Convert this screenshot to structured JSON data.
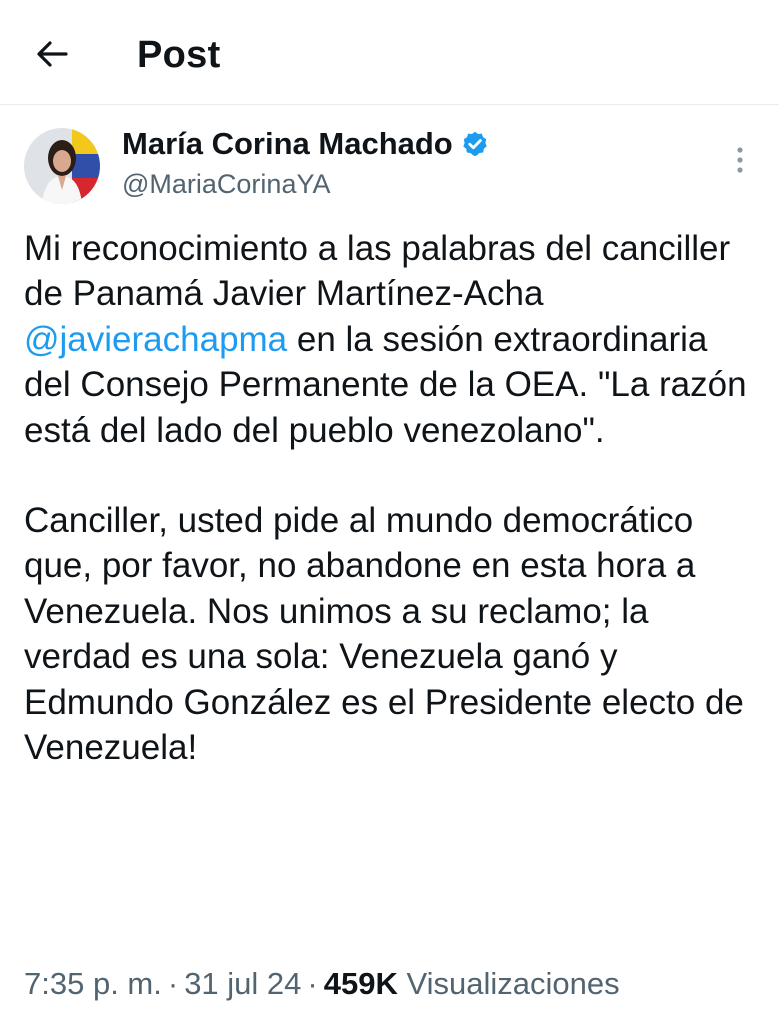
{
  "header": {
    "title": "Post",
    "back_icon": "arrow-left-icon"
  },
  "author": {
    "name": "María Corina Machado",
    "handle": "@MariaCorinaYA",
    "verified_icon": "verified-badge-icon",
    "verified_color": "#1d9bf0"
  },
  "post": {
    "paragraph1": {
      "before_mention": "Mi reconocimiento a las palabras del canciller de Panamá Javier Martínez-Acha ",
      "mention": "@javierachapma",
      "after_mention": " en la sesión extraordinaria del Consejo Permanente de la OEA. \"La razón está del lado del pueblo venezolano\"."
    },
    "paragraph2": "Canciller, usted pide al mundo democrático que, por favor, no abandone en esta hora a Venezuela. Nos unimos a su reclamo; la verdad es una sola: Venezuela ganó y Edmundo González es el Presidente electo de Venezuela!"
  },
  "meta": {
    "time": "7:35 p. m.",
    "separator": "·",
    "date": "31 jul 24",
    "views_count": "459K",
    "views_label": "Visualizaciones"
  },
  "colors": {
    "text": "#0f1419",
    "secondary": "#536471",
    "link": "#1d9bf0",
    "divider": "#e8ecef"
  }
}
